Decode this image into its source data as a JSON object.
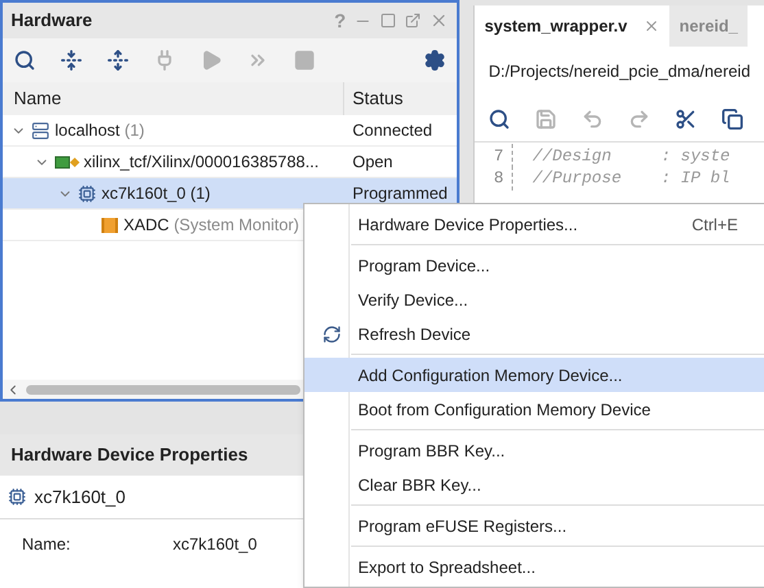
{
  "hardware_panel": {
    "title": "Hardware",
    "window_buttons": [
      "?"
    ],
    "toolbar": [
      {
        "kind": "search",
        "disabled": false
      },
      {
        "kind": "collapse",
        "disabled": false
      },
      {
        "kind": "expand",
        "disabled": false
      },
      {
        "kind": "connect",
        "disabled": true
      },
      {
        "kind": "run",
        "disabled": true
      },
      {
        "kind": "forward",
        "disabled": true
      },
      {
        "kind": "stop",
        "disabled": true
      },
      {
        "kind": "settings",
        "disabled": false
      }
    ],
    "columns": [
      "Name",
      "Status"
    ],
    "tree": [
      {
        "kind": "host",
        "name": "localhost",
        "detail": "(1)",
        "status": "Connected",
        "expanded": true,
        "selected": false,
        "children": [
          {
            "kind": "target",
            "name": "xilinx_tcf/Xilinx/000016385788...",
            "status": "Open",
            "expanded": true,
            "selected": false,
            "children": [
              {
                "kind": "device",
                "name": "xc7k160t_0 (1)",
                "status": "Programmed",
                "expanded": true,
                "selected": true,
                "children": [
                  {
                    "kind": "monitor",
                    "name": "XADC",
                    "detail": "(System Monitor)",
                    "selected": false
                  }
                ]
              }
            ]
          }
        ]
      }
    ]
  },
  "properties_panel": {
    "title": "Hardware Device Properties",
    "device": "xc7k160t_0",
    "fields": [
      {
        "label": "Name:",
        "value": "xc7k160t_0"
      }
    ]
  },
  "editor": {
    "tabs": [
      {
        "label": "system_wrapper.v",
        "selected": true,
        "closable": true
      },
      {
        "label": "nereid_",
        "selected": false,
        "closable": false
      }
    ],
    "path": "D:/Projects/nereid_pcie_dma/nereid",
    "toolbar": [
      {
        "kind": "search",
        "disabled": false
      },
      {
        "kind": "save",
        "disabled": true
      },
      {
        "kind": "undo",
        "disabled": true
      },
      {
        "kind": "redo",
        "disabled": true
      },
      {
        "kind": "cut",
        "disabled": false
      },
      {
        "kind": "copy",
        "disabled": false
      }
    ],
    "lines": [
      {
        "number": "7",
        "text": "//Design     : syste"
      },
      {
        "number": "8",
        "text": "//Purpose    : IP bl"
      }
    ]
  },
  "context_menu": [
    {
      "label": "Hardware Device Properties...",
      "shortcut": "Ctrl+E",
      "selected": false
    },
    {
      "kind": "separator"
    },
    {
      "label": "Program Device...",
      "selected": false
    },
    {
      "label": "Verify Device...",
      "selected": false
    },
    {
      "label": "Refresh Device",
      "selected": false
    },
    {
      "kind": "separator"
    },
    {
      "label": "Add Configuration Memory Device...",
      "selected": true
    },
    {
      "label": "Boot from Configuration Memory Device",
      "selected": false
    },
    {
      "kind": "separator"
    },
    {
      "label": "Program BBR Key...",
      "selected": false
    },
    {
      "label": "Clear BBR Key...",
      "selected": false
    },
    {
      "kind": "separator"
    },
    {
      "label": "Program eFUSE Registers...",
      "selected": false
    },
    {
      "kind": "separator"
    },
    {
      "label": "Export to Spreadsheet...",
      "selected": false
    }
  ]
}
